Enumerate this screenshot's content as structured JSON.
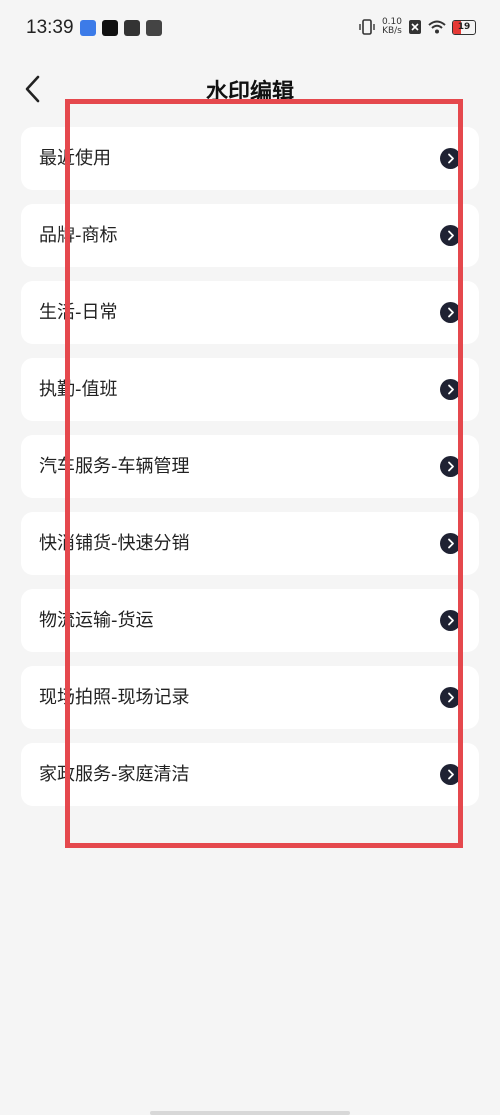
{
  "status_bar": {
    "time": "13:39",
    "net_speed_value": "0.10",
    "net_speed_unit": "KB/s",
    "battery_level": "19"
  },
  "header": {
    "title": "水印编辑"
  },
  "categories": [
    {
      "label": "最近使用"
    },
    {
      "label": "品牌-商标"
    },
    {
      "label": "生活-日常"
    },
    {
      "label": "执勤-值班"
    },
    {
      "label": "汽车服务-车辆管理"
    },
    {
      "label": "快消铺货-快速分销"
    },
    {
      "label": "物流运输-货运"
    },
    {
      "label": "现场拍照-现场记录"
    },
    {
      "label": "家政服务-家庭清洁"
    }
  ],
  "colors": {
    "background": "#f5f5f5",
    "card": "#ffffff",
    "chevron": "#1f2233",
    "highlight_box": "#e5484d"
  },
  "icons": {
    "back": "chevron-left-icon",
    "row_arrow": "chevron-right-circle-icon"
  }
}
